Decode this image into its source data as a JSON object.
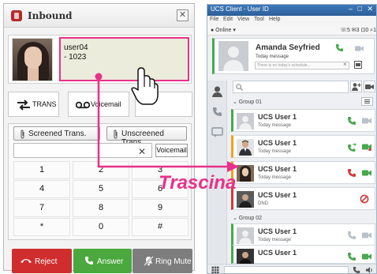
{
  "inbound_dialog": {
    "title": "Inbound",
    "close_glyph": "✕",
    "caller": {
      "name": "user04",
      "extension": "- 1023"
    },
    "actions": {
      "trans": "TRANS",
      "voicemail": "Voicemail"
    },
    "transfer": {
      "screened": "Screened Trans.",
      "unscreened": "Unscreened Trans."
    },
    "dial_input_value": "",
    "clear_glyph": "✕",
    "voicemail_button": "Voicemail",
    "keypad": [
      "1",
      "2",
      "3",
      "4",
      "5",
      "6",
      "7",
      "8",
      "9",
      "*",
      "0",
      "#"
    ],
    "call_buttons": {
      "reject": "Reject",
      "answer": "Answer",
      "ring_mute": "Ring Mute"
    }
  },
  "ucs_client": {
    "title": "UCS Client - User ID",
    "window_controls": "– □ ✕",
    "menu": [
      "File",
      "Edit",
      "View",
      "Tool",
      "Help"
    ],
    "status": "● Online ▾",
    "counts": "☏5 ✉3 ⊡0 ⌕1",
    "profile": {
      "name": "Amanda Seyfried",
      "message": "Today message",
      "schedule_placeholder": "There is no today's schedule..."
    },
    "search_placeholder": "",
    "groups": [
      {
        "label": "⌄ Group 01",
        "contacts": [
          {
            "name": "UCS User 1",
            "message": "Today message",
            "status": "online"
          },
          {
            "name": "UCS User 1",
            "message": "Today message",
            "status": "away"
          },
          {
            "name": "UCS User 1",
            "message": "Today message",
            "status": "away"
          },
          {
            "name": "UCS User 1",
            "message": "DND",
            "status": "dnd"
          }
        ]
      },
      {
        "label": "⌄ Group 02",
        "contacts": [
          {
            "name": "UCS User 1",
            "message": "Today message",
            "status": "online"
          },
          {
            "name": "UCS User 1",
            "message": "",
            "status": "online"
          }
        ]
      }
    ]
  },
  "overlay": {
    "caption": "Trascina"
  },
  "colors": {
    "highlight": "#e8318a",
    "reject": "#d02e2e",
    "answer": "#4aa83e",
    "ring_mute": "#7d7d7d",
    "online": "#47a84d",
    "away": "#f0a020",
    "dnd": "#d23a3a",
    "ucs_titlebar": "#2c5f99"
  }
}
